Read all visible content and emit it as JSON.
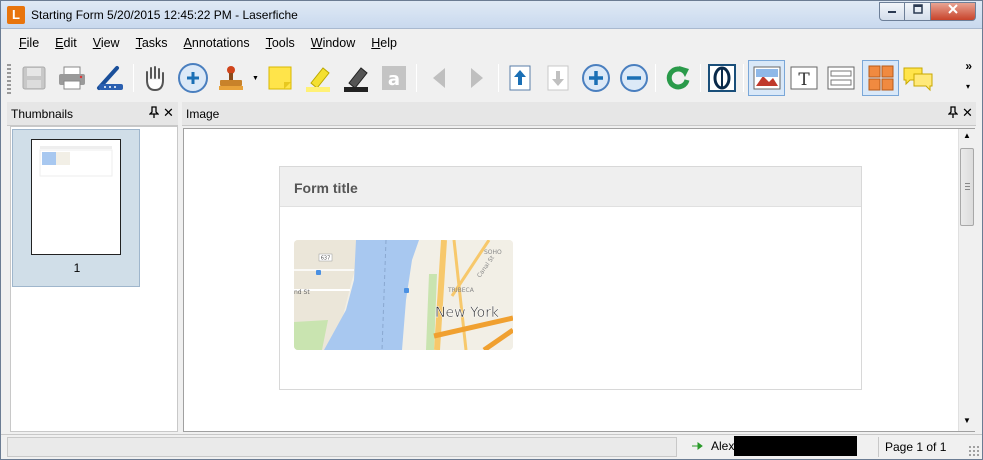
{
  "window": {
    "app_icon_letter": "L",
    "title": "Starting Form 5/20/2015 12:45:22 PM - Laserfiche"
  },
  "menu": [
    {
      "label": "File",
      "mnemonic": "F",
      "rest": "ile"
    },
    {
      "label": "Edit",
      "mnemonic": "E",
      "rest": "dit"
    },
    {
      "label": "View",
      "mnemonic": "V",
      "rest": "iew"
    },
    {
      "label": "Tasks",
      "mnemonic": "T",
      "rest": "asks"
    },
    {
      "label": "Annotations",
      "mnemonic": "A",
      "rest": "nnotations"
    },
    {
      "label": "Tools",
      "mnemonic": "T",
      "rest": "ools"
    },
    {
      "label": "Window",
      "mnemonic": "W",
      "rest": "indow"
    },
    {
      "label": "Help",
      "mnemonic": "H",
      "rest": "elp"
    }
  ],
  "toolbar": {
    "overflow_label": "»",
    "overflow_caret": "▾"
  },
  "thumbnails": {
    "title": "Thumbnails",
    "pin": "📌",
    "close": "✕",
    "items": [
      {
        "page": "1"
      }
    ]
  },
  "image_panel": {
    "title": "Image",
    "pin": "📌",
    "close": "✕"
  },
  "form": {
    "title": "Form title",
    "map": {
      "city_label": "New York",
      "labels": [
        "SOHO",
        "Canal St",
        "TRIBECA",
        "637",
        "nd St"
      ]
    }
  },
  "status": {
    "user": "Alex",
    "page_indicator": "Page 1 of 1"
  },
  "colors": {
    "water": "#a8c8f0",
    "land": "#f2efe6",
    "park": "#c9e4b0",
    "road_major": "#f7c86b",
    "road_highway": "#f0a030",
    "accent_blue": "#1a6fb5"
  }
}
